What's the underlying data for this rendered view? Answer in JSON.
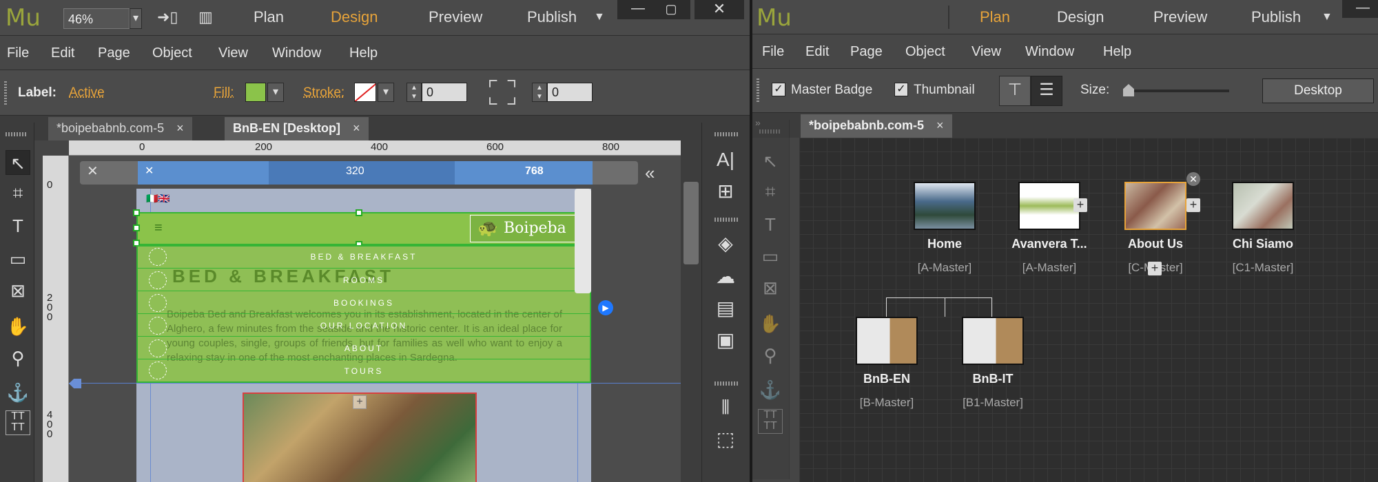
{
  "left": {
    "logo": "Mu",
    "zoom": "46%",
    "nav": [
      "Plan",
      "Design",
      "Preview",
      "Publish"
    ],
    "active_nav": "Design",
    "menu": [
      "File",
      "Edit",
      "Page",
      "Object",
      "View",
      "Window",
      "Help"
    ],
    "control": {
      "label_title": "Label:",
      "label_value": "Active",
      "fill": "Fill:",
      "fill_color": "#8bc34a",
      "stroke": "Stroke:",
      "stroke_value": "0",
      "corner_value": "0"
    },
    "tabs": [
      {
        "label": "*boipebabnb.com-5",
        "close": "×"
      },
      {
        "label": "BnB-EN [Desktop]",
        "close": "×"
      }
    ],
    "ruler_h": [
      "0",
      "200",
      "400",
      "600",
      "800"
    ],
    "ruler_v": [
      "0",
      "200",
      "400"
    ],
    "breakpoints": {
      "left": "320",
      "right": "768"
    },
    "site": {
      "logo_text": "Boipeba",
      "heading": "BED & BREAKFAST",
      "menu": [
        "BED & BREAKFAST",
        "ROOMS",
        "BOOKINGS",
        "OUR LOCATION",
        "ABOUT",
        "TOURS"
      ],
      "body_text": "Boipeba Bed and Breakfast welcomes you in its establishment, located in the center of Alghero, a few minutes from the seaside and the historic center. It is an ideal place for young couples, single, groups of friends, but for families as well who want to enjoy a relaxing stay in one of the most enchanting places in Sardegna."
    }
  },
  "right": {
    "logo": "Mu",
    "nav": [
      "Plan",
      "Design",
      "Preview",
      "Publish"
    ],
    "active_nav": "Plan",
    "menu": [
      "File",
      "Edit",
      "Page",
      "Object",
      "View",
      "Window",
      "Help"
    ],
    "control": {
      "master_badge": "Master Badge",
      "thumbnail": "Thumbnail",
      "size": "Size:",
      "device": "Desktop"
    },
    "tab": {
      "label": "*boipebabnb.com-5",
      "close": "×"
    },
    "pages": [
      {
        "name": "Home",
        "master": "[A-Master]"
      },
      {
        "name": "Avanvera T...",
        "master": "[A-Master]"
      },
      {
        "name": "About Us",
        "master": "[C-Master]"
      },
      {
        "name": "Chi Siamo",
        "master": "[C1-Master]"
      },
      {
        "name": "BnB-EN",
        "master": "[B-Master]"
      },
      {
        "name": "BnB-IT",
        "master": "[B1-Master]"
      }
    ]
  }
}
